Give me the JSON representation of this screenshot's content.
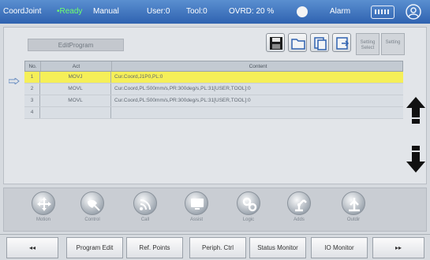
{
  "status": {
    "coord": "CoordJoint",
    "ready": "•Ready",
    "mode": "Manual",
    "user": "User:0",
    "tool": "Tool:0",
    "ovrd": "OVRD: 20 %",
    "alarm": "Alarm"
  },
  "program": {
    "title": "EditProgram",
    "columns": {
      "no": "No.",
      "act": "Act",
      "content": "Content"
    },
    "rows": [
      {
        "no": "1",
        "act": "MOVJ",
        "content": "Cur.Coord,J1P0,PL:0"
      },
      {
        "no": "2",
        "act": "MOVL",
        "content": "Cur.Coord,PL:500mm/s,PR:300deg/s,PL:31[USER,TOOL]:0"
      },
      {
        "no": "3",
        "act": "MOVL",
        "content": "Cur.Coord,PL:500mm/s,PR:300deg/s,PL:31[USER,TOOL]:0"
      },
      {
        "no": "4",
        "act": "",
        "content": ""
      }
    ]
  },
  "toolbar": {
    "icons": [
      "save-icon",
      "open-folder-icon",
      "copy-icon",
      "paste-icon"
    ],
    "setting_select": "Setting Select",
    "setting": "Setting"
  },
  "iconbar": {
    "items": [
      {
        "label": "Motion",
        "icon": "move-arrows-icon"
      },
      {
        "label": "Control",
        "icon": "satellite-icon"
      },
      {
        "label": "Call",
        "icon": "signal-icon"
      },
      {
        "label": "Assist",
        "icon": "monitor-icon"
      },
      {
        "label": "Logic",
        "icon": "gears-icon"
      },
      {
        "label": "Adds",
        "icon": "robot-arm-icon"
      },
      {
        "label": "Outdir",
        "icon": "tower-icon"
      }
    ]
  },
  "softkeys": {
    "prev": "◂◂",
    "program_edit": "Program Edit",
    "ref_points": "Ref. Points",
    "periph_ctrl": "Periph. Ctrl",
    "status_monitor": "Status Monitor",
    "io_monitor": "IO Monitor",
    "next": "▸▸"
  },
  "colors": {
    "status_bar": "#2f62b0",
    "selected_row": "#f5ef58",
    "ready_green": "#6dff6d"
  }
}
